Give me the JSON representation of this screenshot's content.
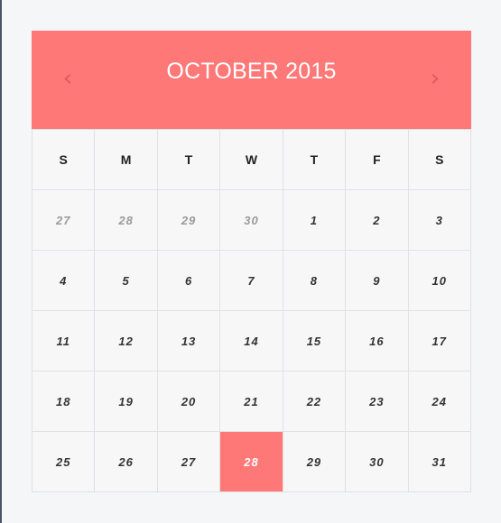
{
  "header": {
    "title": "OCTOBER 2015",
    "prev_icon": "chevron-left-icon",
    "next_icon": "chevron-right-icon",
    "accent_color": "#ff7878"
  },
  "weekdays": [
    "S",
    "M",
    "T",
    "W",
    "T",
    "F",
    "S"
  ],
  "weeks": [
    [
      {
        "d": "27",
        "muted": true
      },
      {
        "d": "28",
        "muted": true
      },
      {
        "d": "29",
        "muted": true
      },
      {
        "d": "30",
        "muted": true
      },
      {
        "d": "1"
      },
      {
        "d": "2"
      },
      {
        "d": "3"
      }
    ],
    [
      {
        "d": "4"
      },
      {
        "d": "5"
      },
      {
        "d": "6"
      },
      {
        "d": "7"
      },
      {
        "d": "8"
      },
      {
        "d": "9"
      },
      {
        "d": "10"
      }
    ],
    [
      {
        "d": "11"
      },
      {
        "d": "12"
      },
      {
        "d": "13"
      },
      {
        "d": "14"
      },
      {
        "d": "15"
      },
      {
        "d": "16"
      },
      {
        "d": "17"
      }
    ],
    [
      {
        "d": "18"
      },
      {
        "d": "19"
      },
      {
        "d": "20"
      },
      {
        "d": "21"
      },
      {
        "d": "22"
      },
      {
        "d": "23"
      },
      {
        "d": "24"
      }
    ],
    [
      {
        "d": "25"
      },
      {
        "d": "26"
      },
      {
        "d": "27"
      },
      {
        "d": "28",
        "selected": true
      },
      {
        "d": "29"
      },
      {
        "d": "30"
      },
      {
        "d": "31"
      }
    ]
  ]
}
